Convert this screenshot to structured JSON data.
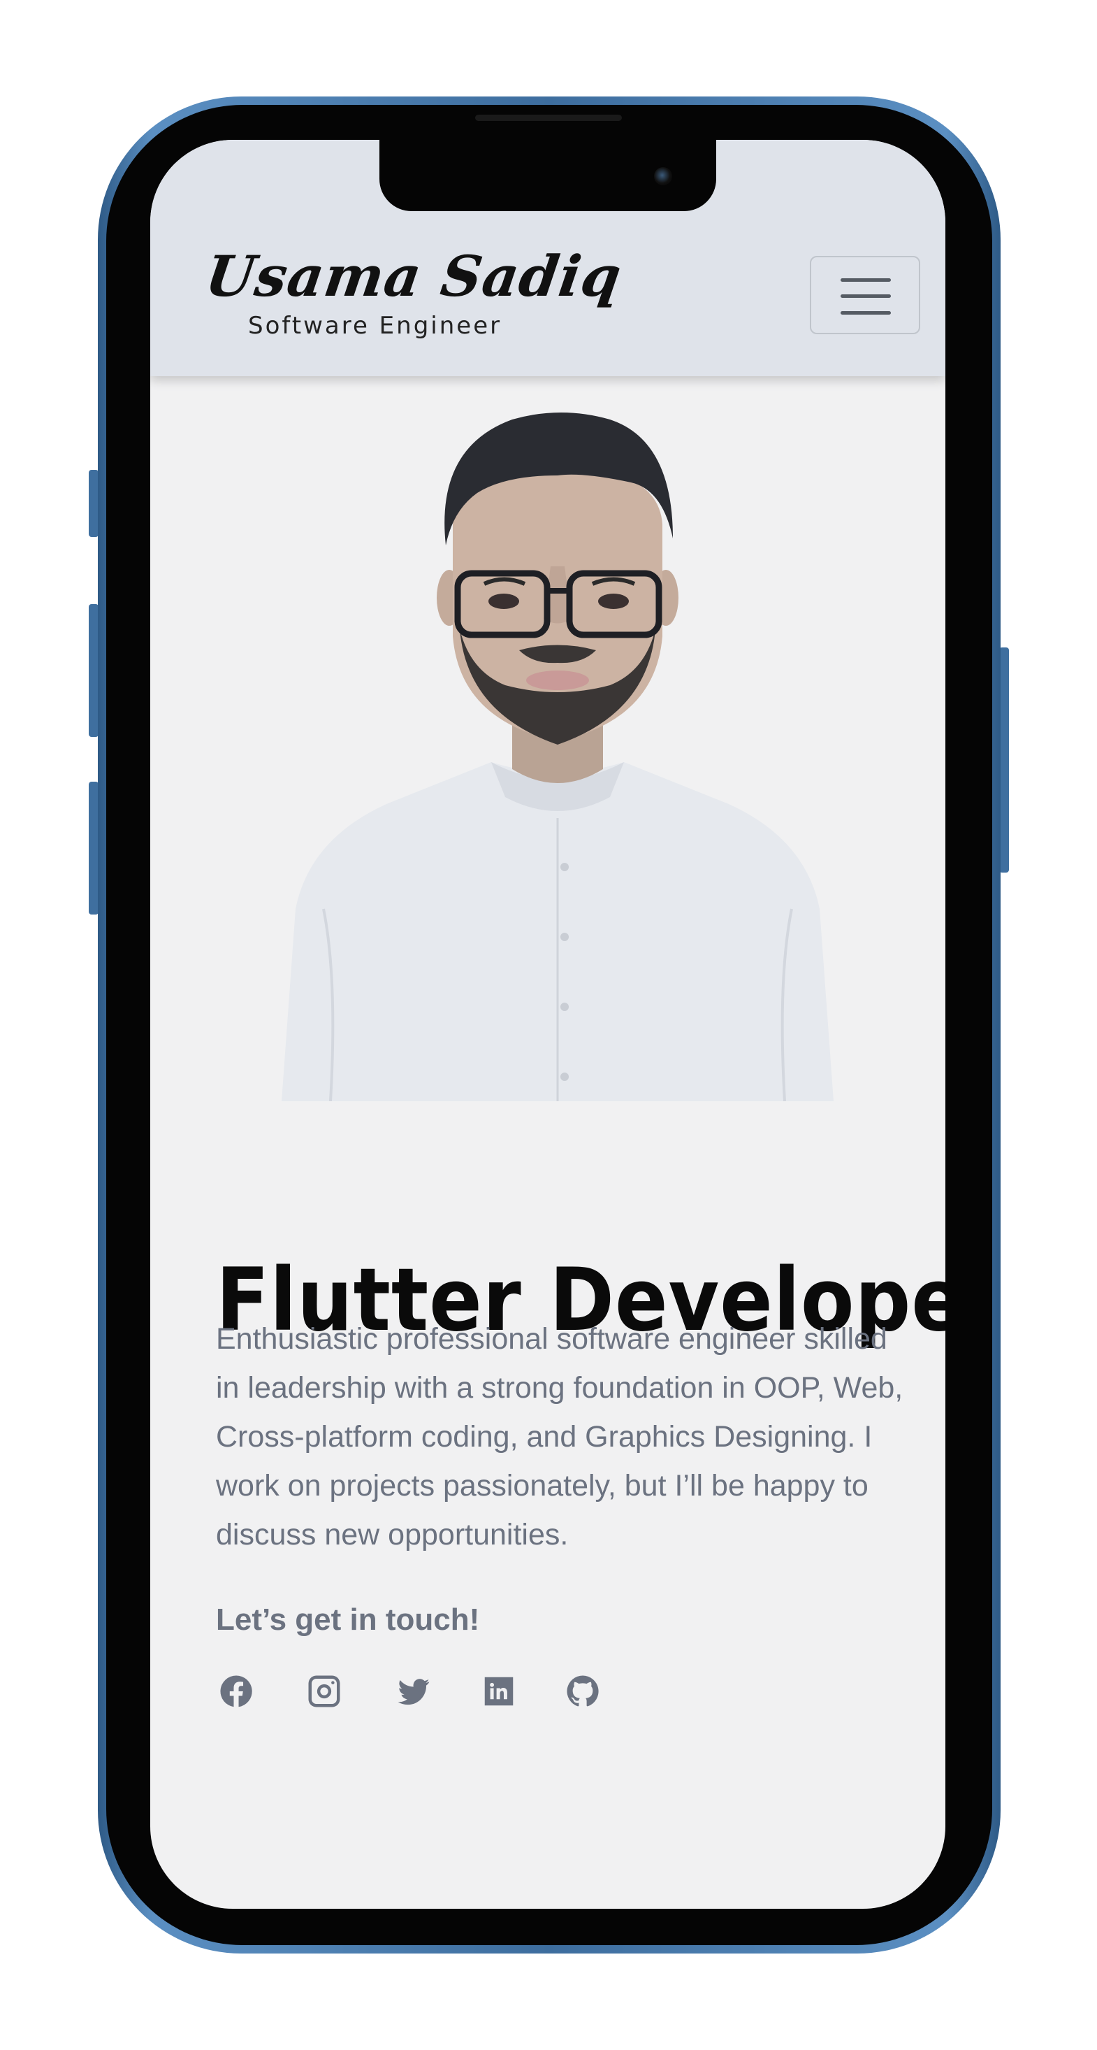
{
  "header": {
    "brand_name": "Usama Sadiq",
    "brand_subtitle": "Software Engineer",
    "menu_icon": "hamburger-menu-icon"
  },
  "hero": {
    "portrait_alt": "Portrait photo",
    "title": "Flutter Developer",
    "description": "Enthusiastic professional software engineer skilled in leadership with a strong foundation in OOP, Web, Cross-platform coding, and Graphics Designing. I work on projects passionately, but I’ll be happy to discuss new opportunities.",
    "cta": "Let’s get in touch!"
  },
  "social_links": [
    {
      "icon": "facebook-icon"
    },
    {
      "icon": "instagram-icon"
    },
    {
      "icon": "twitter-icon"
    },
    {
      "icon": "linkedin-icon"
    },
    {
      "icon": "github-icon"
    }
  ],
  "colors": {
    "header_bg": "#dfe3ea",
    "page_bg": "#f1f1f2",
    "text_muted": "#6b7280",
    "title": "#0a0a0a",
    "phone_frame": "#3d6d9e"
  }
}
